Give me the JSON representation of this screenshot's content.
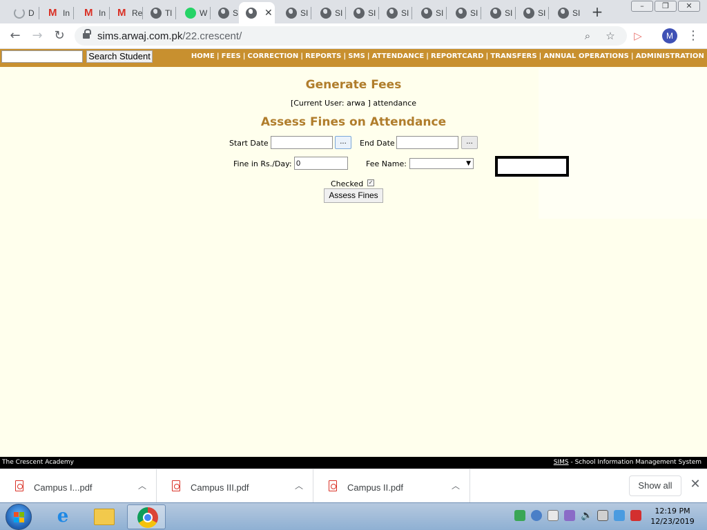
{
  "browser": {
    "tabs": [
      {
        "label": "D",
        "icon": "loading-icon"
      },
      {
        "label": "In",
        "icon": "gmail-icon"
      },
      {
        "label": "In",
        "icon": "gmail-icon"
      },
      {
        "label": "Re",
        "icon": "gmail-icon"
      },
      {
        "label": "Tl",
        "icon": "globe-icon"
      },
      {
        "label": "W",
        "icon": "whatsapp-icon"
      },
      {
        "label": "SI",
        "icon": "globe-icon"
      },
      {
        "label": "",
        "icon": "globe-icon",
        "active": true
      },
      {
        "label": "SI",
        "icon": "globe-icon"
      },
      {
        "label": "SI",
        "icon": "globe-icon"
      },
      {
        "label": "SI",
        "icon": "globe-icon"
      },
      {
        "label": "SI",
        "icon": "globe-icon"
      },
      {
        "label": "SI",
        "icon": "globe-icon"
      },
      {
        "label": "SI",
        "icon": "globe-icon"
      },
      {
        "label": "SI",
        "icon": "globe-icon"
      },
      {
        "label": "SI",
        "icon": "globe-icon"
      },
      {
        "label": "SI",
        "icon": "globe-icon"
      }
    ],
    "url_host": "sims.arwaj.com.pk",
    "url_path": "/22.crescent/",
    "profile_initial": "M"
  },
  "site": {
    "search_button": "Search Student",
    "search_value": "",
    "menu": [
      "HOME",
      "FEES",
      "CORRECTION",
      "REPORTS",
      "SMS",
      "ATTENDANCE",
      "REPORTCARD",
      "TRANSFERS",
      "ANNUAL OPERATIONS",
      "ADMINISTRATION"
    ],
    "menu_separator": "|",
    "accent_color": "#c8902f",
    "heading_color": "#b07d2c"
  },
  "main": {
    "title": "Generate Fees",
    "user_line": "[Current User: arwa ] attendance",
    "subtitle": "Assess Fines on Attendance",
    "start_date_label": "Start Date",
    "start_date_value": "",
    "end_date_label": "End Date",
    "end_date_value": "",
    "picker_label": "...",
    "fine_label": "Fine in Rs./Day:",
    "fine_value": "0",
    "fee_name_label": "Fee Name:",
    "fee_name_selected": "",
    "checked_label": "Checked",
    "checked": true,
    "assess_button": "Assess Fines"
  },
  "footer": {
    "left": "The Crescent Academy",
    "right_link": "SIMS",
    "right_text": " - School Information Management System"
  },
  "downloads": {
    "items": [
      "Campus I...pdf",
      "Campus III.pdf",
      "Campus II.pdf"
    ],
    "show_all": "Show all"
  },
  "taskbar": {
    "time": "12:19 PM",
    "date": "12/23/2019"
  }
}
